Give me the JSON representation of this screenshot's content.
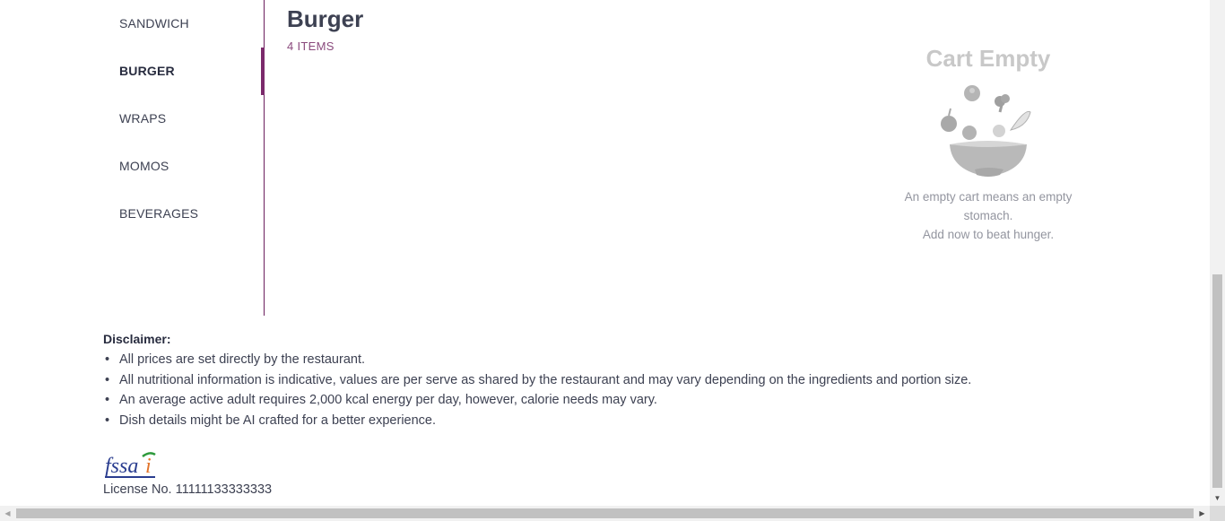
{
  "categories": {
    "items": [
      {
        "label": "SANDWICH",
        "active": false
      },
      {
        "label": "BURGER",
        "active": true
      },
      {
        "label": "WRAPS",
        "active": false
      },
      {
        "label": "MOMOS",
        "active": false
      },
      {
        "label": "BEVERAGES",
        "active": false
      }
    ]
  },
  "menu": {
    "title": "Burger",
    "count": "4 ITEMS"
  },
  "cart": {
    "title": "Cart Empty",
    "message_line1": "An empty cart means an empty stomach.",
    "message_line2": "Add now to beat hunger."
  },
  "disclaimer": {
    "title": "Disclaimer:",
    "points": [
      "All prices are set directly by the restaurant.",
      "All nutritional information is indicative, values are per serve as shared by the restaurant and may vary depending on the ingredients and portion size.",
      "An average active adult requires 2,000 kcal energy per day, however, calorie needs may vary.",
      "Dish details might be AI crafted for a better experience."
    ]
  },
  "fssai": {
    "logo_text": "fssai",
    "license": "License No. 11111133333333"
  },
  "colors": {
    "accent": "#7b2a6b",
    "muted_purple": "#8a4a7d",
    "cart_gray": "#c8c8c8"
  },
  "icons": {
    "cart_illustration": "empty-bowl-with-vegetables"
  }
}
